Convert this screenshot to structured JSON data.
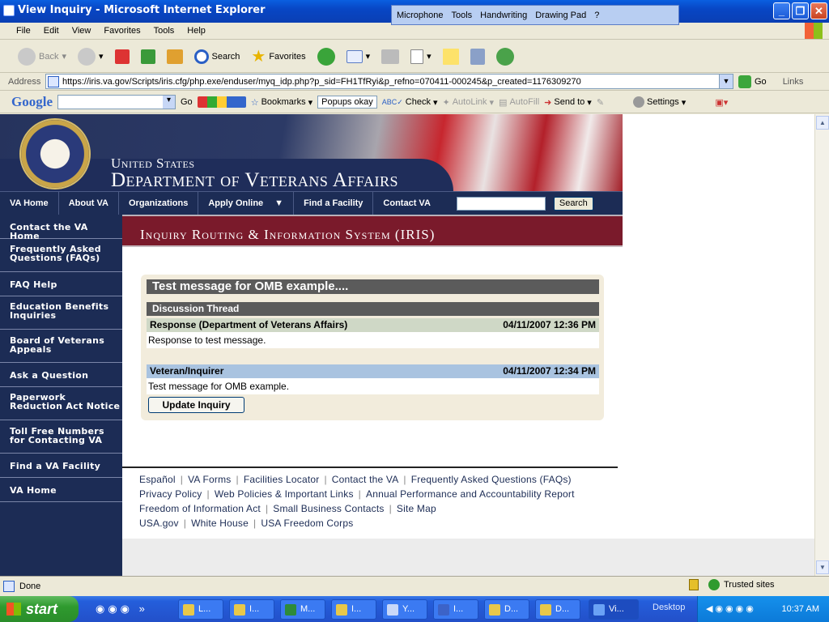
{
  "window": {
    "title": "View Inquiry - Microsoft Internet Explorer"
  },
  "langbar": {
    "items": [
      "Microphone",
      "Tools",
      "Handwriting",
      "Drawing Pad",
      "?"
    ]
  },
  "menu": [
    "File",
    "Edit",
    "View",
    "Favorites",
    "Tools",
    "Help"
  ],
  "toolbar": {
    "back": "Back",
    "search": "Search",
    "favorites": "Favorites"
  },
  "address": {
    "label": "Address",
    "url": "https://iris.va.gov/Scripts/iris.cfg/php.exe/enduser/myq_idp.php?p_sid=FH1TfRyi&p_refno=070411-000245&p_created=1176309270",
    "go": "Go",
    "links": "Links"
  },
  "googlebar": {
    "logo": "Google",
    "go": "Go",
    "bookmarks": "Bookmarks",
    "popups": "Popups okay",
    "check": "Check",
    "autolink": "AutoLink",
    "autofill": "AutoFill",
    "sendto": "Send to",
    "settings": "Settings"
  },
  "va": {
    "united_states": "United States",
    "department": "Department of Veterans Affairs",
    "nav": [
      "VA Home",
      "About VA",
      "Organizations",
      "Apply Online",
      "Find a Facility",
      "Contact VA"
    ],
    "search_button": "Search",
    "left_nav": [
      "Contact the VA Home",
      "Frequently Asked Questions (FAQs)",
      "FAQ Help",
      "Education Benefits Inquiries",
      "Board of Veterans Appeals",
      "Ask a Question",
      "Paperwork Reduction Act Notice",
      "Toll Free Numbers for Contacting VA",
      "Find a VA Facility",
      "VA Home"
    ],
    "iris_title": "Inquiry Routing & Information System (IRIS)"
  },
  "inquiry": {
    "subject": "Test message for OMB example....",
    "thread_label": "Discussion Thread",
    "entries": [
      {
        "author": "Response (Department of Veterans Affairs)",
        "date": "04/11/2007 12:36 PM",
        "body": "Response to test message."
      },
      {
        "author": "Veteran/Inquirer",
        "date": "04/11/2007 12:34 PM",
        "body": "Test message for OMB example."
      }
    ],
    "update_button": "Update Inquiry"
  },
  "footer": {
    "rows": [
      [
        "Español",
        "VA Forms",
        "Facilities Locator",
        "Contact the VA",
        "Frequently Asked Questions (FAQs)"
      ],
      [
        "Privacy Policy",
        "Web Policies & Important Links",
        "Annual Performance and Accountability Report"
      ],
      [
        "Freedom of Information Act",
        "Small Business Contacts",
        "Site Map"
      ],
      [
        "USA.gov",
        "White House",
        "USA Freedom Corps"
      ]
    ]
  },
  "status": {
    "text": "Done",
    "zone": "Trusted sites"
  },
  "taskbar": {
    "start": "start",
    "buttons": [
      "L...",
      "I...",
      "M...",
      "I...",
      "Y...",
      "I...",
      "D...",
      "D...",
      "Vi..."
    ],
    "desktop": "Desktop",
    "clock": "10:37 AM"
  }
}
